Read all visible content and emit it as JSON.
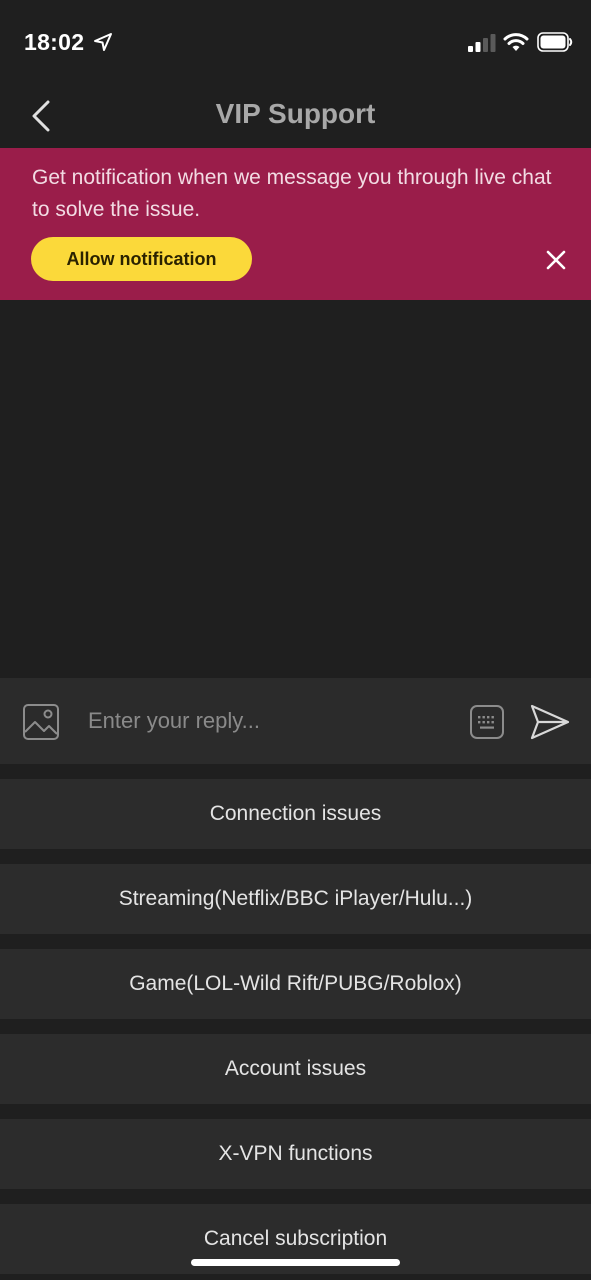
{
  "status_bar": {
    "time": "18:02",
    "icons": [
      "location-arrow-icon",
      "signal-icon",
      "wifi-icon",
      "battery-icon"
    ]
  },
  "nav": {
    "title": "VIP Support",
    "back_icon": "chevron-left-icon"
  },
  "banner": {
    "text": "Get notification when we message you through live chat to solve the issue.",
    "button_label": "Allow notification",
    "close_icon": "close-icon",
    "background_color": "#9a1d4a",
    "button_color": "#fbd93a"
  },
  "input_bar": {
    "placeholder": "Enter your reply...",
    "value": "",
    "left_icon": "image-icon",
    "keyboard_icon": "keyboard-icon",
    "send_icon": "send-icon"
  },
  "quick_replies": [
    {
      "label": "Connection issues"
    },
    {
      "label": "Streaming(Netflix/BBC iPlayer/Hulu...)"
    },
    {
      "label": "Game(LOL-Wild Rift/PUBG/Roblox)"
    },
    {
      "label": "Account issues"
    },
    {
      "label": "X-VPN functions"
    },
    {
      "label": "Cancel subscription"
    }
  ]
}
